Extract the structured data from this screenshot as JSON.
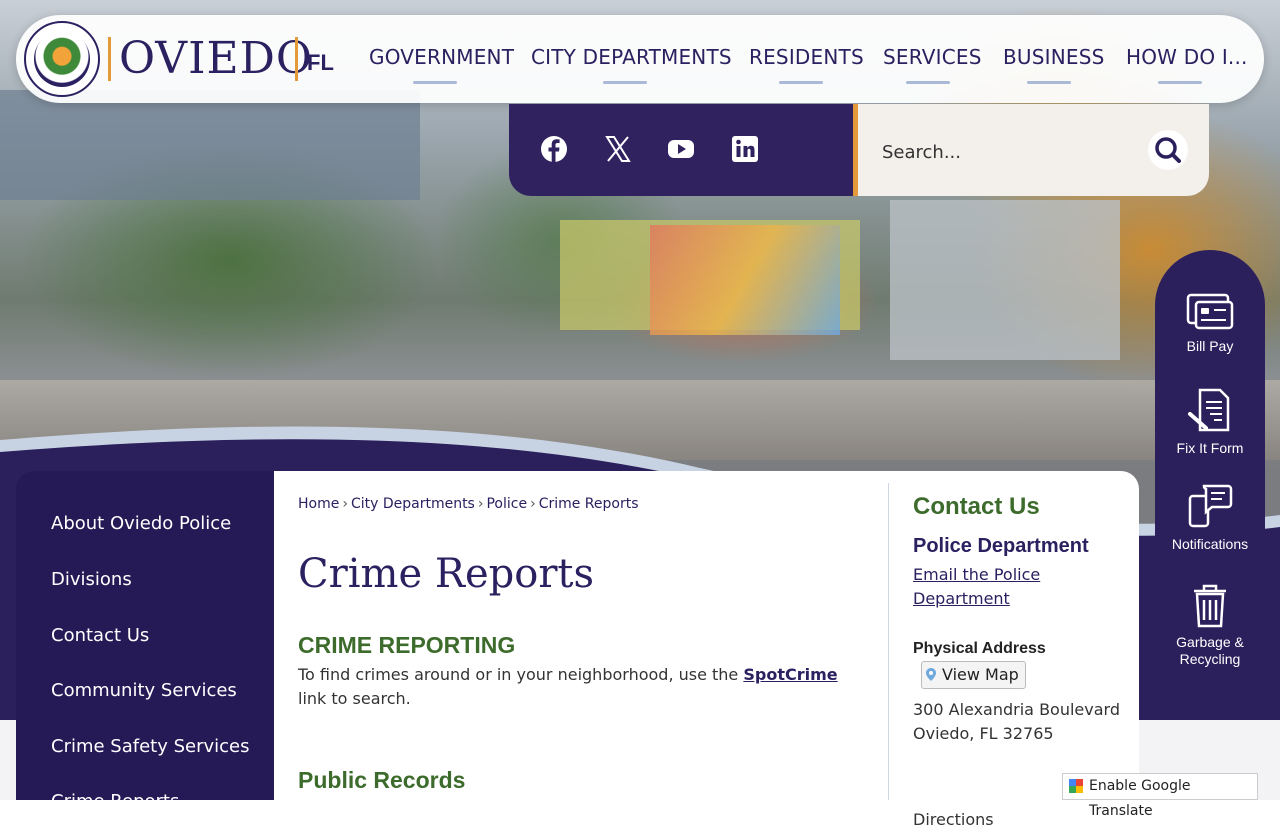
{
  "site": {
    "name": "OVIEDO",
    "state": "FL"
  },
  "nav": [
    "GOVERNMENT",
    "CITY DEPARTMENTS",
    "RESIDENTS",
    "SERVICES",
    "BUSINESS",
    "HOW DO I..."
  ],
  "social": {
    "icons": [
      "facebook-icon",
      "x-icon",
      "youtube-icon",
      "linkedin-icon"
    ]
  },
  "search": {
    "placeholder": "Search..."
  },
  "quick_links": [
    {
      "label": "Bill Pay",
      "icon": "bill-pay-icon"
    },
    {
      "label": "Fix It Form",
      "icon": "fix-it-form-icon"
    },
    {
      "label": "Notifications",
      "icon": "notifications-icon"
    },
    {
      "label": "Garbage & Recycling",
      "icon": "trash-can-icon"
    }
  ],
  "sidebar": [
    "About Oviedo Police",
    "Divisions",
    "Contact Us",
    "Community Services",
    "Crime Safety Services",
    "Crime Reports"
  ],
  "breadcrumb": [
    "Home",
    "City Departments",
    "Police",
    "Crime Reports"
  ],
  "page": {
    "title": "Crime Reports",
    "section1_heading": "CRIME REPORTING",
    "section1_before": "To find crimes around or in your neighborhood, use the ",
    "section1_link": "SpotCrime",
    "section1_after": " link to search.",
    "section2_heading": "Public Records"
  },
  "contact": {
    "heading": "Contact Us",
    "dept": "Police Department",
    "email_label": "Email the Police Department",
    "address_label": "Physical Address",
    "view_map": "View Map",
    "address_line1": "300 Alexandria Boulevard",
    "address_line2": "Oviedo, FL 32765",
    "directions": "Directions"
  },
  "translate": {
    "label": "Enable Google Translate"
  },
  "colors": {
    "brand_purple": "#2b1f5c",
    "accent_orange": "#e49a3a",
    "heading_green": "#3c6b2c"
  }
}
